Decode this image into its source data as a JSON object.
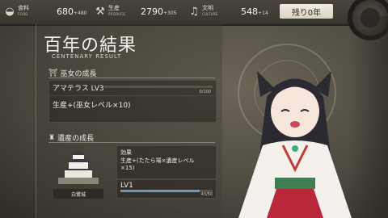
{
  "top_bar": {
    "food": {
      "label": "食料",
      "sub": "FOOD",
      "value": "680",
      "delta": "+480",
      "icon": "food-bowl-icon"
    },
    "production": {
      "label": "生産",
      "sub": "PRODUCE",
      "value": "2790",
      "delta": "+305",
      "icon": "crossed-tools-icon"
    },
    "culture": {
      "label": "文明",
      "sub": "CULTURE",
      "value": "548",
      "delta": "+14",
      "icon": "book-icon"
    },
    "remaining_years": "残り0年"
  },
  "result": {
    "title": "百年の結果",
    "subtitle": "CENTENARY RESULT"
  },
  "miko_section": {
    "header": "巫女の成長",
    "name_level": "アマテラス LV3",
    "exp_text": "0/100",
    "exp_fraction": 0.0,
    "effect": "生産+(巫女レベル×10)"
  },
  "heritage_section": {
    "header": "遺産の成長",
    "building_name": "白鷺城",
    "effect_label": "効果",
    "effect_line1": "生産+(たたら場×遺産レベル",
    "effect_line2": "×15)",
    "level": "LV1",
    "exp_text": "43/50",
    "exp_fraction": 0.86
  },
  "colors": {
    "accent_bar": "#6f98b8",
    "panel_text": "#f1ede3"
  }
}
